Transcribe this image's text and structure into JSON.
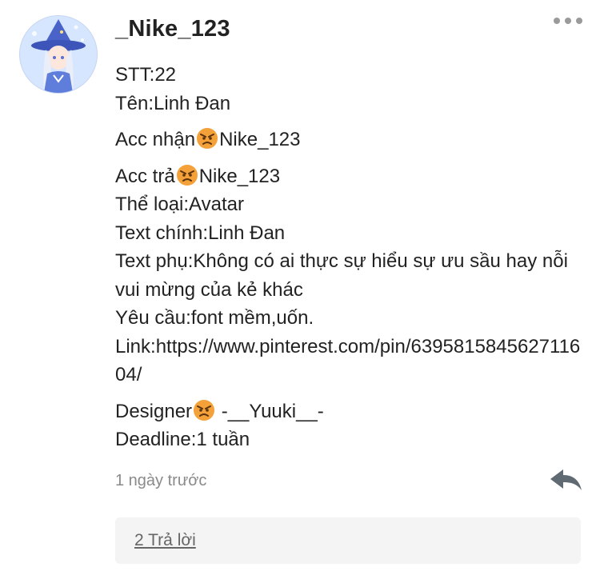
{
  "post": {
    "username": "_Nike_123",
    "lines": {
      "stt": "STT:22",
      "name": "Tên:Linh Đan",
      "receiver_prefix": "Acc nhận",
      "receiver_name": "Nike_123",
      "payer_prefix": "Acc trả",
      "payer_name": "Nike_123",
      "category": "Thể loại:Avatar",
      "main_text": "Text chính:Linh Đan",
      "sub_text": "Text phụ:Không có ai thực sự hiểu sự ưu sầu hay nỗi vui mừng của kẻ khác",
      "request": "Yêu cầu:font mềm,uốn.",
      "link": "Link:https://www.pinterest.com/pin/639581584562711604/",
      "designer_prefix": "Designer",
      "designer_name": " -__Yuuki__-",
      "deadline": "Deadline:1 tuần"
    },
    "emoji_icon": "angry-face-emoji",
    "timestamp": "1 ngày trước",
    "replies_label": "2 Trả lời"
  },
  "icons": {
    "menu": "more-horizontal-icon",
    "reply": "reply-arrow-icon",
    "avatar": "witch-character-avatar"
  },
  "colors": {
    "text": "#222222",
    "muted": "#8a8a8a",
    "reply_box_bg": "#f4f4f4",
    "emoji": "#f4a623"
  }
}
